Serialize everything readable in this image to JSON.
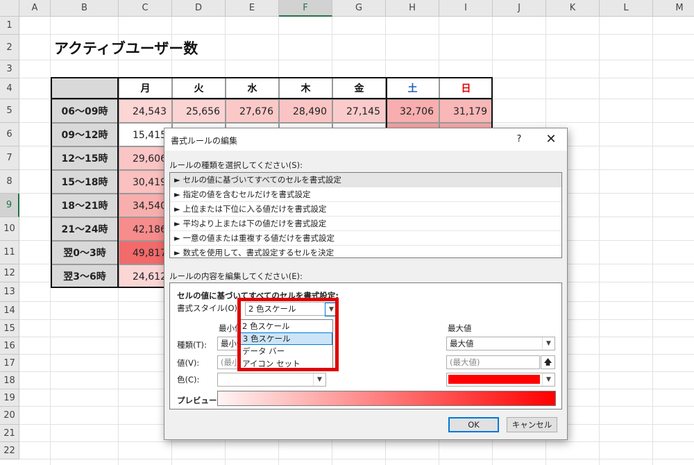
{
  "columns": [
    "A",
    "B",
    "C",
    "D",
    "E",
    "F",
    "G",
    "H",
    "I",
    "J",
    "K",
    "L",
    "M"
  ],
  "selected_column": "F",
  "rows": [
    "1",
    "2",
    "3",
    "4",
    "5",
    "6",
    "7",
    "8",
    "9",
    "10",
    "11",
    "12",
    "13",
    "14",
    "15",
    "16",
    "17",
    "18",
    "19",
    "20",
    "21",
    "22"
  ],
  "selected_row": "9",
  "sheet_title": "アクティブユーザー数",
  "table": {
    "headers": [
      "月",
      "火",
      "水",
      "木",
      "金",
      "土",
      "日"
    ],
    "header_colors": [
      "#111111",
      "#111111",
      "#111111",
      "#111111",
      "#111111",
      "#1f5fbf",
      "#e00000"
    ],
    "row_labels": [
      "06～09時",
      "09～12時",
      "12～15時",
      "15～18時",
      "18～21時",
      "21～24時",
      "翌0～3時",
      "翌3～6時"
    ],
    "cells": [
      [
        "24,543",
        "25,656",
        "27,676",
        "28,490",
        "27,145",
        "32,706",
        "31,179"
      ],
      [
        "15,415",
        "",
        "",
        "",
        "",
        "",
        ""
      ],
      [
        "29,606",
        "",
        "",
        "",
        "",
        "",
        ""
      ],
      [
        "30,419",
        "",
        "",
        "",
        "",
        "",
        ""
      ],
      [
        "34,540",
        "",
        "",
        "",
        "",
        "",
        ""
      ],
      [
        "42,186",
        "",
        "",
        "",
        "",
        "",
        ""
      ],
      [
        "49,817",
        "",
        "",
        "",
        "",
        "",
        ""
      ],
      [
        "24,612",
        "",
        "",
        "",
        "",
        "",
        ""
      ]
    ],
    "fills": [
      [
        "#fcd5d5",
        "#fcd3d3",
        "#fbc8c8",
        "#fbc4c4",
        "#fbcbcb",
        "#f8aeae",
        "#f9b7b7"
      ],
      [
        "#ffffff",
        "#ffffff",
        "#ffffff",
        "#ffffff",
        "#ffffff",
        "#f6a4a4",
        "#f7aaaa"
      ],
      [
        "#fbc5c5",
        "#ffffff",
        "#ffffff",
        "#ffffff",
        "#ffffff",
        "#ffffff",
        "#ffffff"
      ],
      [
        "#fbc0c0",
        "#ffffff",
        "#ffffff",
        "#ffffff",
        "#ffffff",
        "#ffffff",
        "#ffffff"
      ],
      [
        "#f9aeae",
        "#ffffff",
        "#ffffff",
        "#ffffff",
        "#ffffff",
        "#ffffff",
        "#ffffff"
      ],
      [
        "#f68c8c",
        "#ffffff",
        "#ffffff",
        "#ffffff",
        "#ffffff",
        "#ffffff",
        "#ffffff"
      ],
      [
        "#f26a6a",
        "#ffffff",
        "#ffffff",
        "#ffffff",
        "#ffffff",
        "#ffffff",
        "#ffffff"
      ],
      [
        "#fcd5d5",
        "#ffffff",
        "#ffffff",
        "#ffffff",
        "#ffffff",
        "#ffffff",
        "#ffffff"
      ]
    ]
  },
  "dialog": {
    "title": "書式ルールの編集",
    "help": "?",
    "close": "✕",
    "rule_type_label": "ルールの種類を選択してください(S):",
    "rule_types": [
      "► セルの値に基づいてすべてのセルを書式設定",
      "► 指定の値を含むセルだけを書式設定",
      "► 上位または下位に入る値だけを書式設定",
      "► 平均より上または下の値だけを書式設定",
      "► 一意の値または重複する値だけを書式設定",
      "► 数式を使用して、書式設定するセルを決定"
    ],
    "edit_label": "ルールの内容を編集してください(E):",
    "section_heading": "セルの値に基づいてすべてのセルを書式設定:",
    "format_style_label": "書式スタイル(O):",
    "format_style_value": "2 色スケール",
    "dropdown_options": [
      "2 色スケール",
      "3 色スケール",
      "データ バー",
      "アイコン セット"
    ],
    "min_header": "最小値",
    "max_header": "最大値",
    "type_label": "種類(T):",
    "min_type": "最小値",
    "max_type": "最大値",
    "value_label": "値(V):",
    "min_value_placeholder": "(最小値)",
    "max_value_placeholder": "(最大値)",
    "color_label": "色(C):",
    "max_color": "#ff0000",
    "preview_label": "プレビュー:",
    "ok": "OK",
    "cancel": "キャンセル"
  }
}
